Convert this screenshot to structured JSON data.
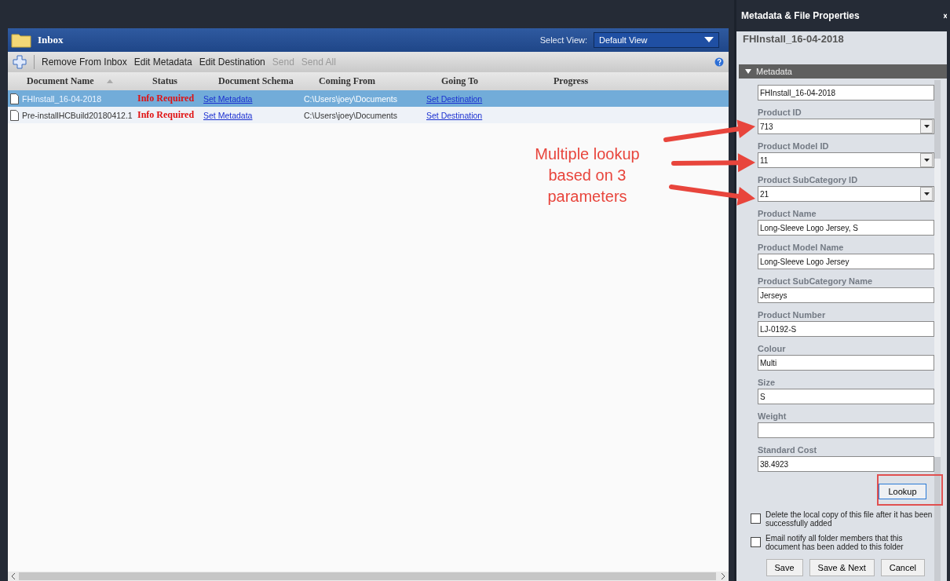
{
  "inbox": {
    "title": "Inbox",
    "select_view_label": "Select View:",
    "select_view_value": "Default View"
  },
  "toolbar": [
    {
      "label": "Remove From Inbox",
      "disabled": false
    },
    {
      "label": "Edit Metadata",
      "disabled": false
    },
    {
      "label": "Edit Destination",
      "disabled": false
    },
    {
      "label": "Send",
      "disabled": true
    },
    {
      "label": "Send All",
      "disabled": true
    }
  ],
  "table": {
    "columns": [
      {
        "label": "Document Name",
        "sorted": true
      },
      {
        "label": "Status",
        "sorted": false
      },
      {
        "label": "Document Schema",
        "sorted": false
      },
      {
        "label": "Coming From",
        "sorted": false
      },
      {
        "label": "Going To",
        "sorted": false
      },
      {
        "label": "Progress",
        "sorted": false
      }
    ],
    "rows": [
      {
        "name": "FHInstall_16-04-2018",
        "status": "Info Required",
        "schema": "Set Metadata",
        "from": "C:\\Users\\joey\\Documents",
        "to": "Set Destination",
        "selected": true
      },
      {
        "name": "Pre-installHCBuild20180412.1",
        "status": "Info Required",
        "schema": "Set Metadata",
        "from": "C:\\Users\\joey\\Documents",
        "to": "Set Destination",
        "selected": false
      }
    ]
  },
  "panel": {
    "title": "Metadata & File Properties",
    "file_name": "FHInstall_16-04-2018",
    "section": {
      "label": "Metadata",
      "expanded": true
    },
    "fields": [
      {
        "kind": "text",
        "value": "FHInstall_16-04-2018"
      },
      {
        "kind": "dropdown",
        "label": "Product ID",
        "value": "713"
      },
      {
        "kind": "dropdown",
        "label": "Product Model ID",
        "value": "11"
      },
      {
        "kind": "dropdown",
        "label": "Product SubCategory ID",
        "value": "21"
      },
      {
        "kind": "text",
        "label": "Product Name",
        "value": "Long-Sleeve Logo Jersey, S"
      },
      {
        "kind": "text",
        "label": "Product Model Name",
        "value": "Long-Sleeve Logo Jersey"
      },
      {
        "kind": "text",
        "label": "Product SubCategory Name",
        "value": "Jerseys"
      },
      {
        "kind": "text",
        "label": "Product Number",
        "value": "LJ-0192-S"
      },
      {
        "kind": "text",
        "label": "Colour",
        "value": "Multi"
      },
      {
        "kind": "text",
        "label": "Size",
        "value": "S"
      },
      {
        "kind": "text",
        "label": "Weight"
      },
      {
        "kind": "text",
        "label": "Standard Cost",
        "value": "38.4923"
      }
    ],
    "lookup_button": "Lookup",
    "checkboxes": [
      {
        "label": "Delete the local copy of this file after it has been successfully added",
        "checked": false
      },
      {
        "label": "Email notify all folder members that this document has been added to this folder",
        "checked": false
      }
    ],
    "buttons": [
      "Save",
      "Save & Next",
      "Cancel"
    ]
  },
  "annotation": {
    "text": "Multiple lookup based on 3 parameters"
  }
}
